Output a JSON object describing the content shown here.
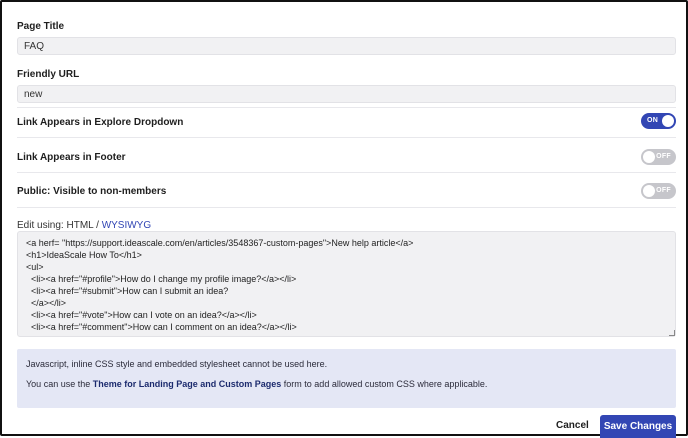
{
  "page_title": {
    "label": "Page Title",
    "value": "FAQ"
  },
  "friendly_url": {
    "label": "Friendly URL",
    "value": "new"
  },
  "toggles": [
    {
      "label": "Link Appears in Explore Dropdown",
      "state": "ON"
    },
    {
      "label": "Link Appears in Footer",
      "state": "OFF"
    },
    {
      "label": "Public: Visible to non-members",
      "state": "OFF"
    }
  ],
  "editor": {
    "prefix": "Edit using:",
    "mode_html": "HTML",
    "separator": "/",
    "mode_wysiwyg": "WYSIWYG",
    "content": "<a herf= \"https://support.ideascale.com/en/articles/3548367-custom-pages\">New help article</a>\n<h1>IdeaScale How To</h1>\n<ul>\n  <li><a href=\"#profile\">How do I change my profile image?</a></li>\n  <li><a href=\"#submit\">How can I submit an idea?\n  </a></li>\n  <li><a href=\"#vote\">How can I vote on an idea?</a></li>\n  <li><a href=\"#comment\">How can I comment on an idea?</a></li>"
  },
  "notice": {
    "line1": "Javascript, inline CSS style and embedded stylesheet cannot be used here.",
    "line2_pre": "You can use the",
    "line2_link": "Theme for Landing Page and Custom Pages",
    "line2_post": "form to add allowed custom CSS where applicable."
  },
  "actions": {
    "cancel": "Cancel",
    "save": "Save Changes"
  },
  "colors": {
    "accent": "#3246b4",
    "notice_bg": "#e4e7f5",
    "toggle_off": "#c6c6cb"
  }
}
